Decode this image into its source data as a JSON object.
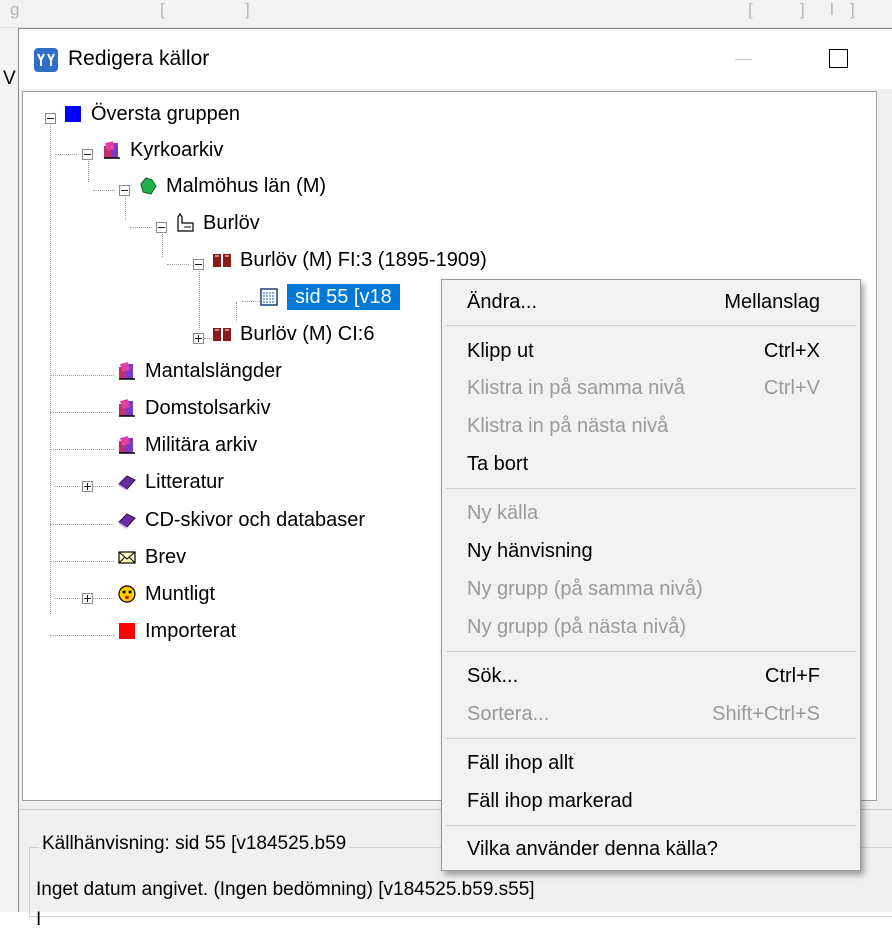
{
  "background": {
    "fragments": [
      "g",
      "[",
      "]",
      "[",
      "]",
      "l",
      "]"
    ],
    "left_char": "V"
  },
  "window": {
    "title": "Redigera källor",
    "icon_text": "ww"
  },
  "tree": {
    "nodes": [
      {
        "label": "Översta gruppen",
        "icon": "blue-square-icon"
      },
      {
        "label": "Kyrkoarkiv",
        "icon": "archive-books-icon"
      },
      {
        "label": "Malmöhus län (M)",
        "icon": "county-map-icon"
      },
      {
        "label": "Burlöv",
        "icon": "church-icon"
      },
      {
        "label": "Burlöv (M) FI:3 (1895-1909)",
        "icon": "open-book-icon"
      },
      {
        "label": "sid  55 [v18",
        "icon": "page-icon"
      },
      {
        "label": "Burlöv (M) CI:6",
        "icon": "open-book-icon"
      },
      {
        "label": "Mantalslängder",
        "icon": "archive-books-icon"
      },
      {
        "label": "Domstolsarkiv",
        "icon": "archive-books-icon"
      },
      {
        "label": "Militära arkiv",
        "icon": "archive-books-icon"
      },
      {
        "label": "Litteratur",
        "icon": "purple-book-icon"
      },
      {
        "label": "CD-skivor och databaser",
        "icon": "purple-book-icon"
      },
      {
        "label": "Brev",
        "icon": "envelope-icon"
      },
      {
        "label": "Muntligt",
        "icon": "face-icon"
      },
      {
        "label": "Importerat",
        "icon": "red-square-icon"
      }
    ]
  },
  "menu": {
    "items": [
      {
        "label": "Ändra...",
        "shortcut": "Mellanslag",
        "enabled": true
      },
      {
        "label": "Klipp ut",
        "shortcut": "Ctrl+X",
        "enabled": true
      },
      {
        "label": "Klistra in på samma nivå",
        "shortcut": "Ctrl+V",
        "enabled": false
      },
      {
        "label": "Klistra in på nästa nivå",
        "shortcut": "",
        "enabled": false
      },
      {
        "label": "Ta bort",
        "shortcut": "",
        "enabled": true
      },
      {
        "label": "Ny källa",
        "shortcut": "",
        "enabled": false
      },
      {
        "label": "Ny hänvisning",
        "shortcut": "",
        "enabled": true
      },
      {
        "label": "Ny grupp (på samma nivå)",
        "shortcut": "",
        "enabled": false
      },
      {
        "label": "Ny grupp (på nästa nivå)",
        "shortcut": "",
        "enabled": false
      },
      {
        "label": "Sök...",
        "shortcut": "Ctrl+F",
        "enabled": true
      },
      {
        "label": "Sortera...",
        "shortcut": "Shift+Ctrl+S",
        "enabled": false
      },
      {
        "label": "Fäll ihop allt",
        "shortcut": "",
        "enabled": true
      },
      {
        "label": "Fäll ihop markerad",
        "shortcut": "",
        "enabled": true
      },
      {
        "label": "Vilka använder denna källa?",
        "shortcut": "",
        "enabled": true
      }
    ]
  },
  "info": {
    "group_label": "Källhänvisning: sid  55 [v184525.b59",
    "line1": "Inget datum angivet. (Ingen bedömning) [v184525.b59.s55]",
    "line2": "I"
  },
  "colors": {
    "selection": "#0078d7",
    "menu_bg": "#f2f2f2",
    "disabled_text": "#9a9a9a"
  }
}
